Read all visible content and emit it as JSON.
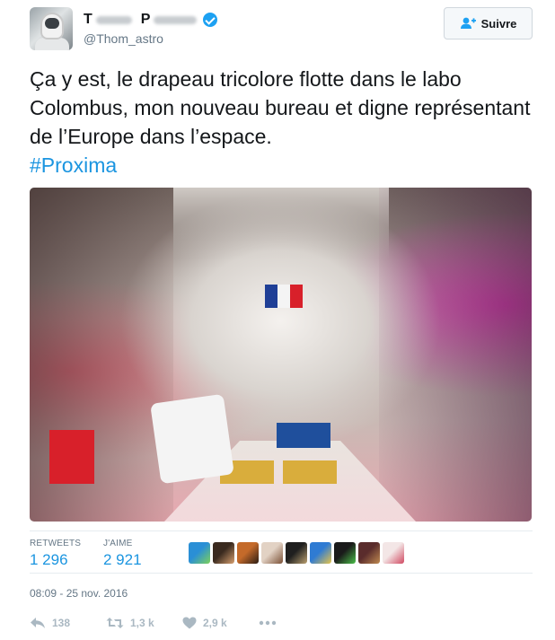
{
  "author": {
    "handle": "@Thom_astro",
    "name_initial_1": "T",
    "name_initial_2": "P",
    "verified_icon": "verified-badge-icon"
  },
  "follow_button": {
    "label": "Suivre",
    "icon": "add-user-icon"
  },
  "tweet": {
    "text": "Ça y est, le drapeau tricolore flotte dans le labo Colombus, mon nouveau bureau et digne représentant de l’Europe dans l’espace.",
    "hashtag": "#Proxima"
  },
  "media": {
    "image": "photo-columbus-lab-interior"
  },
  "stats": {
    "retweets_label": "RETWEETS",
    "retweets_value": "1 296",
    "likes_label": "J'AIME",
    "likes_value": "2 921",
    "liker_avatars": [
      {
        "color1": "#2a8fd6",
        "color2": "#7dd15a"
      },
      {
        "color1": "#3a2a1f",
        "color2": "#d8a070"
      },
      {
        "color1": "#c46a2a",
        "color2": "#2b1c14"
      },
      {
        "color1": "#e2d2c4",
        "color2": "#7a4f35"
      },
      {
        "color1": "#1f1f1f",
        "color2": "#bba070"
      },
      {
        "color1": "#2f7bd3",
        "color2": "#e7c44a"
      },
      {
        "color1": "#1a1a1a",
        "color2": "#4cc04a"
      },
      {
        "color1": "#5a2c2c",
        "color2": "#c08a50"
      },
      {
        "color1": "#f3e6e6",
        "color2": "#d04860"
      }
    ]
  },
  "timestamp": "08:09 - 25 nov. 2016",
  "actions": {
    "reply_count": "138",
    "retweet_count": "1,3 k",
    "like_count": "2,9 k",
    "reply_icon": "reply-icon",
    "retweet_icon": "retweet-icon",
    "like_icon": "heart-icon",
    "more_icon": "more-dots-icon"
  },
  "colors": {
    "link": "#1b95e0",
    "muted": "#657786",
    "action_gray": "#aab8c2",
    "verified": "#1da1f2"
  }
}
